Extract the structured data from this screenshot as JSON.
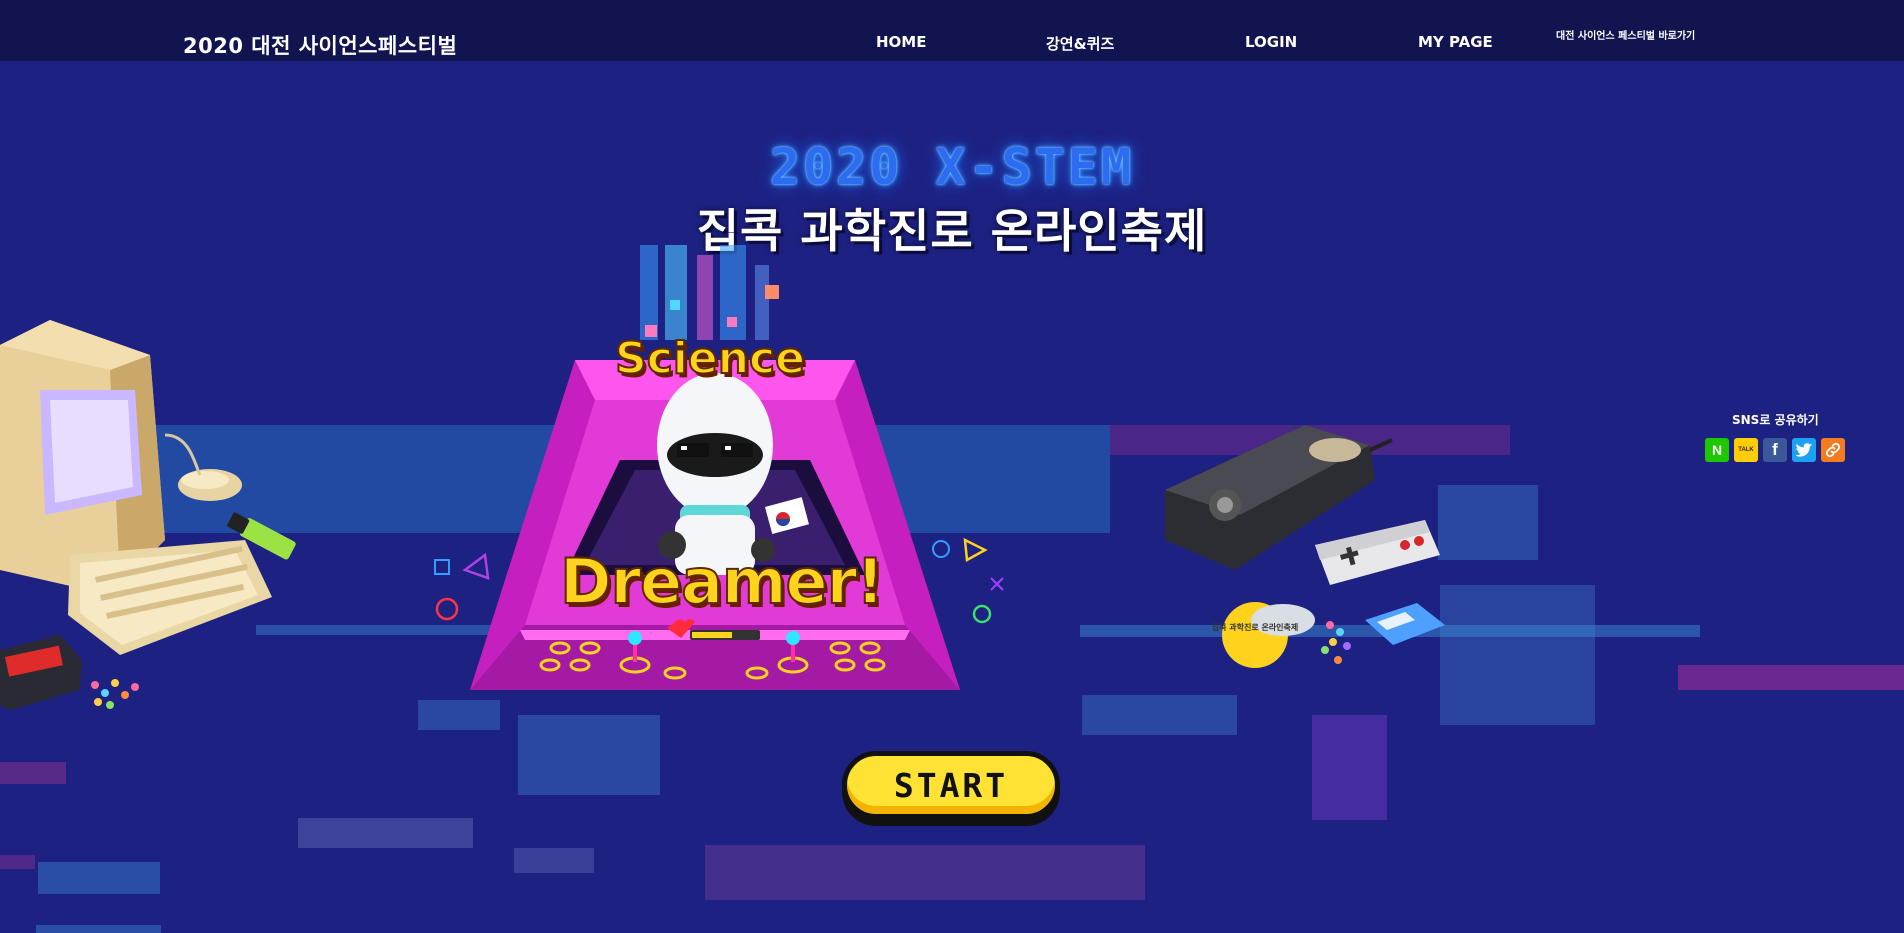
{
  "header": {
    "brand": "2020 대전 사이언스페스티벌",
    "nav": [
      {
        "label": "HOME"
      },
      {
        "label": "강연&퀴즈"
      },
      {
        "label": "LOGIN"
      },
      {
        "label": "MY PAGE"
      }
    ],
    "shortcut": "대전 사이언스 페스티벌 바로가기"
  },
  "hero": {
    "title_en": "2020 X-STEM",
    "title_ko": "집콕 과학진로 온라인축제",
    "arcade_top": "Science",
    "arcade_bottom": "Dreamer!",
    "start": "START",
    "badge": "집콕 과학진로 온라인축제"
  },
  "sns": {
    "title": "SNS로 공유하기",
    "buttons": [
      {
        "name": "naver",
        "icon": "naver-icon",
        "glyph": "N",
        "color": "#1ec800"
      },
      {
        "name": "kakaotalk",
        "icon": "kakaotalk-icon",
        "glyph": "TALK",
        "color": "#ffcd00"
      },
      {
        "name": "facebook",
        "icon": "facebook-icon",
        "glyph": "f",
        "color": "#3b5998"
      },
      {
        "name": "twitter",
        "icon": "twitter-icon",
        "glyph": "",
        "color": "#1da1f2"
      },
      {
        "name": "link-copy",
        "icon": "link-icon",
        "glyph": "",
        "color": "#f57b20"
      }
    ]
  },
  "colors": {
    "background": "#1d2182",
    "header": "#11144f",
    "title_glow": "#2c6cf0",
    "arcade_pink": "#e23ad6",
    "start_yellow": "#ffe234"
  }
}
